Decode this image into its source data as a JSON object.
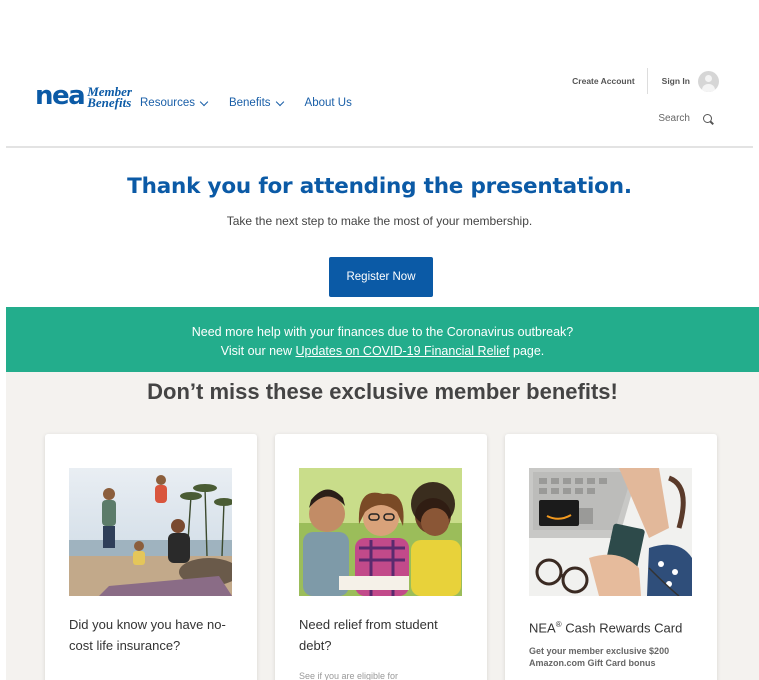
{
  "header": {
    "logo": {
      "nea": "nea",
      "line1": "Member",
      "line2": "Benefits"
    },
    "nav": [
      {
        "label": "Resources",
        "has_dropdown": true
      },
      {
        "label": "Benefits",
        "has_dropdown": true
      },
      {
        "label": "About Us",
        "has_dropdown": false
      }
    ],
    "create_account": "Create Account",
    "sign_in": "Sign In",
    "search_label": "Search",
    "icons": {
      "search": "search-icon",
      "avatar": "user-avatar-icon",
      "dropdown": "chevron-down-icon"
    }
  },
  "hero": {
    "title": "Thank you for attending the presentation.",
    "subtitle": "Take the next step to make the most of your membership.",
    "cta": "Register Now"
  },
  "banner": {
    "line1": "Need more help with your finances due to the Coronavirus outbreak?",
    "line2_pre": "Visit our new ",
    "link": "Updates on COVID-19 Financial Relief",
    "line2_post": " page."
  },
  "benefits": {
    "title": "Don’t miss these exclusive member benefits!",
    "cards": [
      {
        "title": "Did you know you have no-cost life insurance?",
        "subtitle": ""
      },
      {
        "title": "Need relief from student debt?",
        "subtitle": "See if you are eligible for"
      },
      {
        "title_pre": "NEA",
        "title_sup": "®",
        "title_post": " Cash Rewards Card",
        "subtitle": "Get your member exclusive $200 Amazon.com Gift Card bonus"
      }
    ]
  },
  "colors": {
    "brand_blue": "#0b5aa6",
    "banner_green": "#23ad8c",
    "section_bg": "#f4f2ef"
  }
}
